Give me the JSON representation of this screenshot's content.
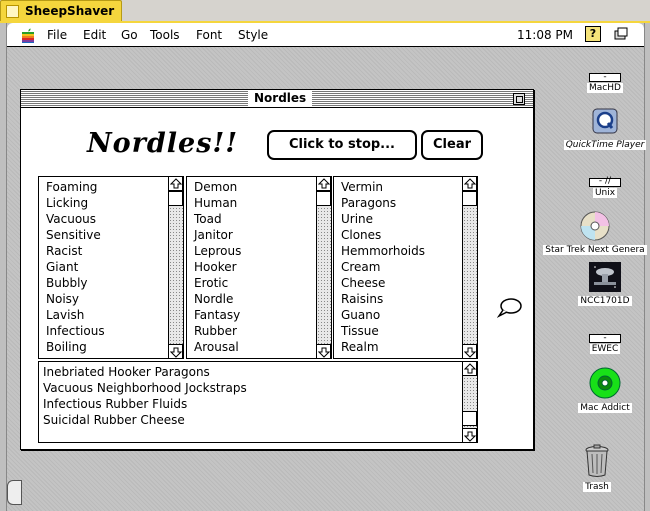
{
  "host": {
    "tab_title": "SheepShaver"
  },
  "menubar": {
    "items": [
      "File",
      "Edit",
      "Go",
      "Tools",
      "Font",
      "Style"
    ],
    "clock": "11:08 PM",
    "help_icon_label": "?"
  },
  "window": {
    "title": "Nordles",
    "app_title": "Nordles!!",
    "stop_button": "Click to stop...",
    "clear_button": "Clear"
  },
  "lists": {
    "adjectives": [
      "Foaming",
      "Licking",
      "Vacuous",
      "Sensitive",
      "Racist",
      "Giant",
      "Bubbly",
      "Noisy",
      "Lavish",
      "Infectious",
      "Boiling"
    ],
    "nouns1": [
      "Demon",
      "Human",
      "Toad",
      "Janitor",
      "Leprous",
      "Hooker",
      "Erotic",
      "Nordle",
      "Fantasy",
      "Rubber",
      "Arousal"
    ],
    "nouns2": [
      "Vermin",
      "Paragons",
      "Urine",
      "Clones",
      "Hemmorhoids",
      "Cream",
      "Cheese",
      "Raisins",
      "Guano",
      "Tissue",
      "Realm"
    ]
  },
  "results": [
    "Inebriated Hooker Paragons",
    "Vacuous Neighborhood Jockstraps",
    "Infectious Rubber Fluids",
    "Suicidal Rubber Cheese"
  ],
  "desktop_icons": {
    "machd": "MacHD",
    "quicktime": "QuickTime Player",
    "unix": "Unix",
    "startrek": "Star Trek Next Genera",
    "ncc": "NCC1701D",
    "ewec": "EWEC",
    "macaddict": "Mac Addict",
    "trash": "Trash"
  },
  "colors": {
    "tab_yellow": "#f5d63d",
    "mac_addict_green": "#18e018"
  }
}
